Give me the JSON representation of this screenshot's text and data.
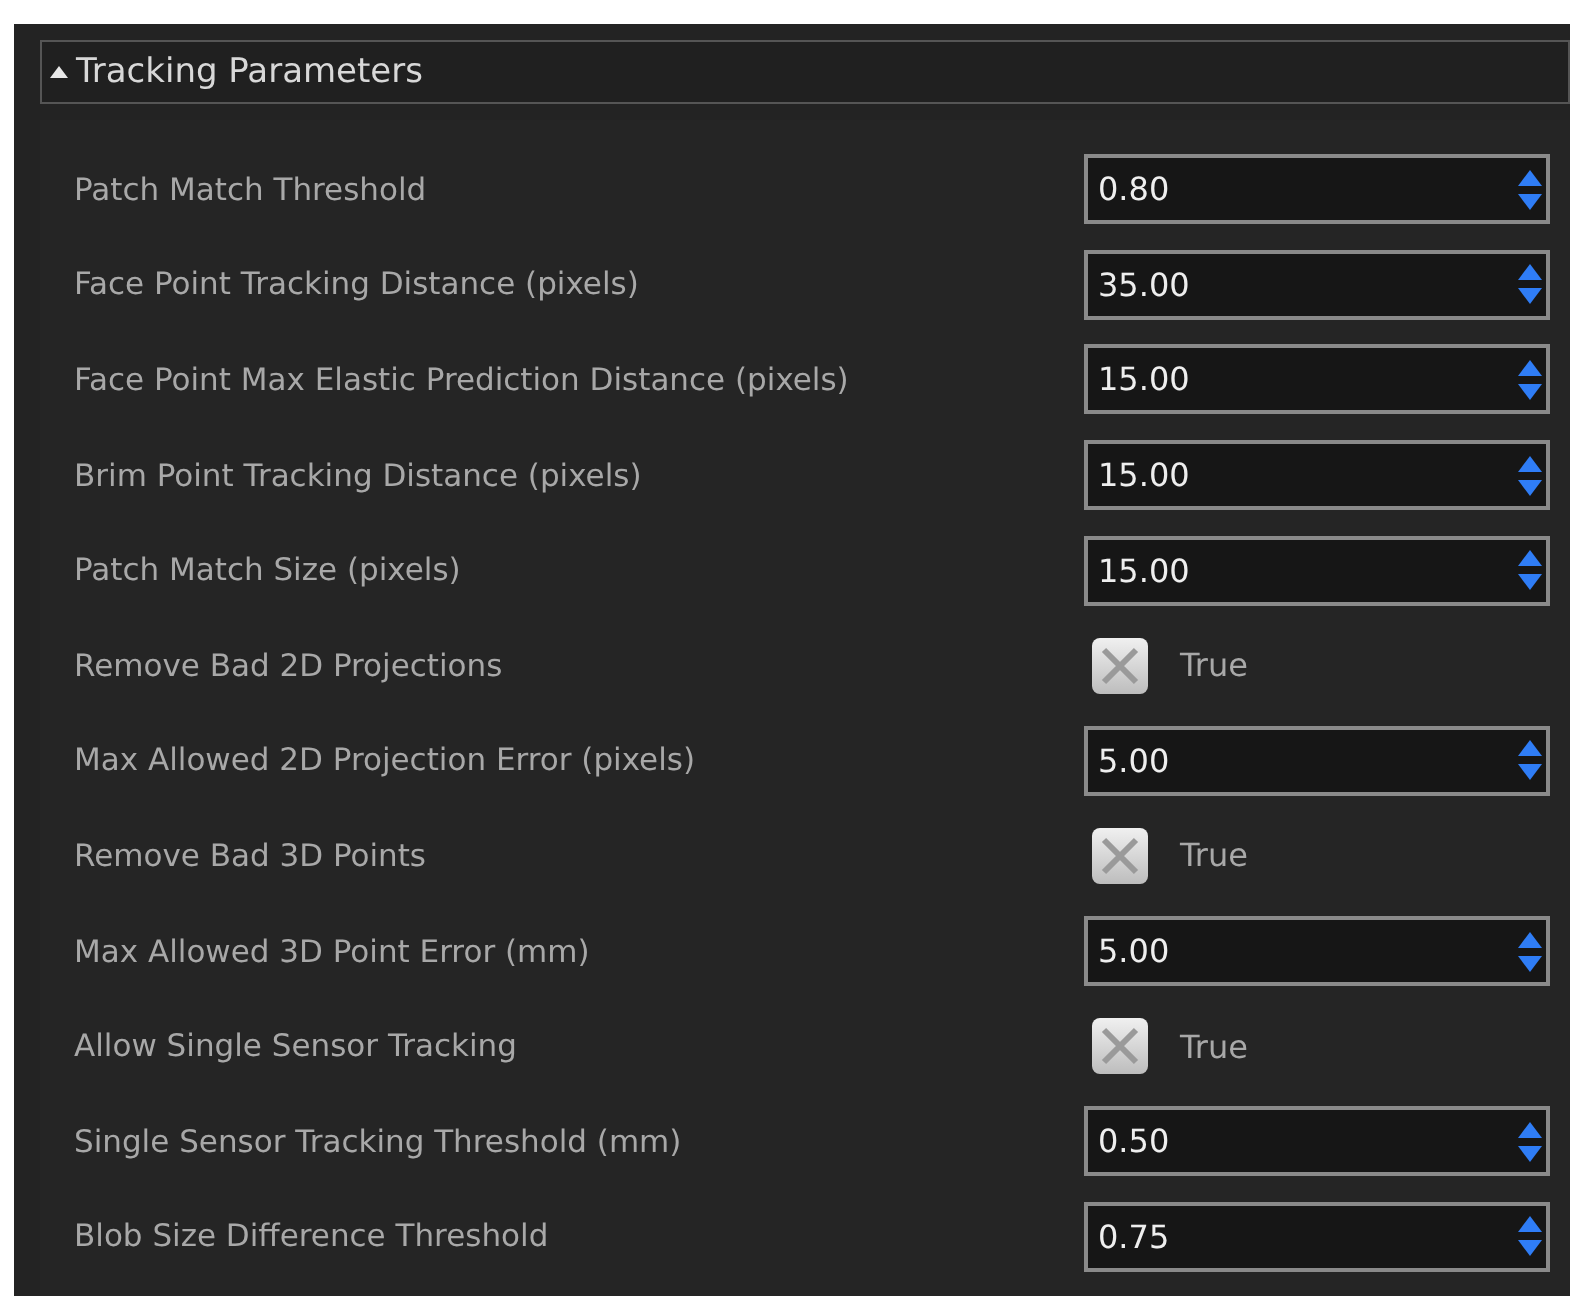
{
  "section": {
    "title": "Tracking Parameters",
    "expanded": true
  },
  "rows": [
    {
      "kind": "spin",
      "label": "Patch Match Threshold",
      "value": "0.80"
    },
    {
      "kind": "spin",
      "label": "Face Point Tracking Distance (pixels)",
      "value": "35.00"
    },
    {
      "kind": "spin",
      "label": "Face Point Max Elastic Prediction Distance (pixels)",
      "value": "15.00"
    },
    {
      "kind": "spin",
      "label": "Brim Point Tracking Distance (pixels)",
      "value": "15.00"
    },
    {
      "kind": "spin",
      "label": "Patch Match Size (pixels)",
      "value": "15.00"
    },
    {
      "kind": "check",
      "label": "Remove Bad 2D Projections",
      "checked": true,
      "value": "True"
    },
    {
      "kind": "spin",
      "label": "Max Allowed 2D Projection Error (pixels)",
      "value": "5.00"
    },
    {
      "kind": "check",
      "label": "Remove Bad 3D Points",
      "checked": true,
      "value": "True"
    },
    {
      "kind": "spin",
      "label": "Max Allowed 3D Point Error (mm)",
      "value": "5.00"
    },
    {
      "kind": "check",
      "label": "Allow Single Sensor Tracking",
      "checked": true,
      "value": "True"
    },
    {
      "kind": "spin",
      "label": "Single Sensor Tracking Threshold (mm)",
      "value": "0.50"
    },
    {
      "kind": "spin",
      "label": "Blob Size Difference Threshold",
      "value": "0.75"
    }
  ]
}
